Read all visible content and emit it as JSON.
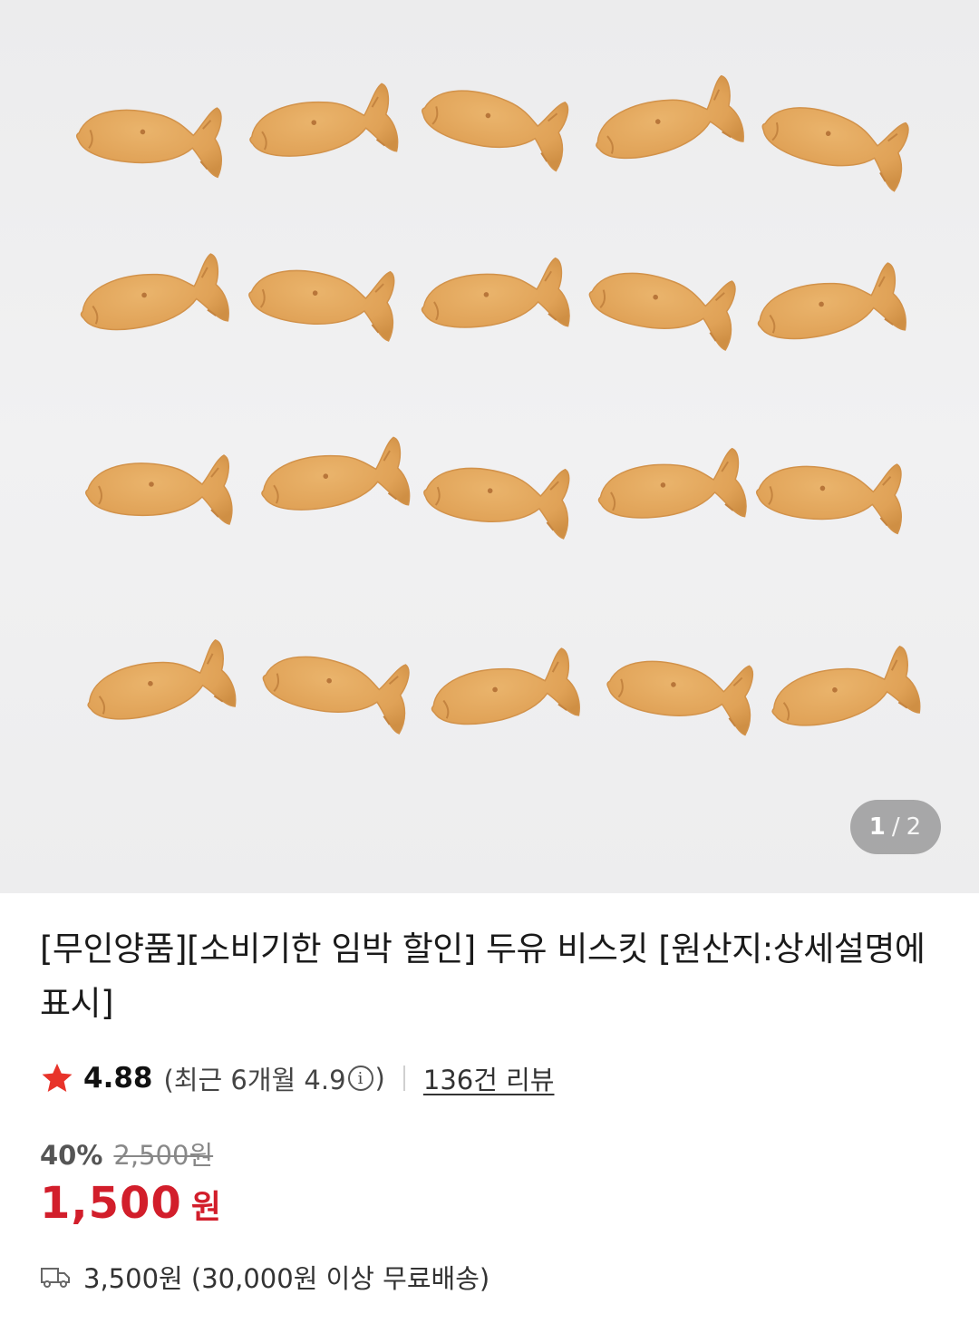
{
  "gallery": {
    "current": "1",
    "separator": "/",
    "total": "2"
  },
  "product": {
    "title": "[무인양품][소비기한 임박 할인] 두유 비스킷 [원산지:상세설명에 표시]"
  },
  "rating": {
    "value": "4.88",
    "recent_prefix": "(최근 6개월 4.9",
    "recent_suffix": ")",
    "info_symbol": "i",
    "review_count": "136건 리뷰"
  },
  "pricing": {
    "discount_rate": "40%",
    "original_price": "2,500원",
    "price": "1,500",
    "currency": "원"
  },
  "shipping": {
    "text": "3,500원 (30,000원 이상 무료배송)"
  },
  "colors": {
    "accent_red": "#d21e2b",
    "star": "#e8332a",
    "cookie": "#e2a55a"
  }
}
